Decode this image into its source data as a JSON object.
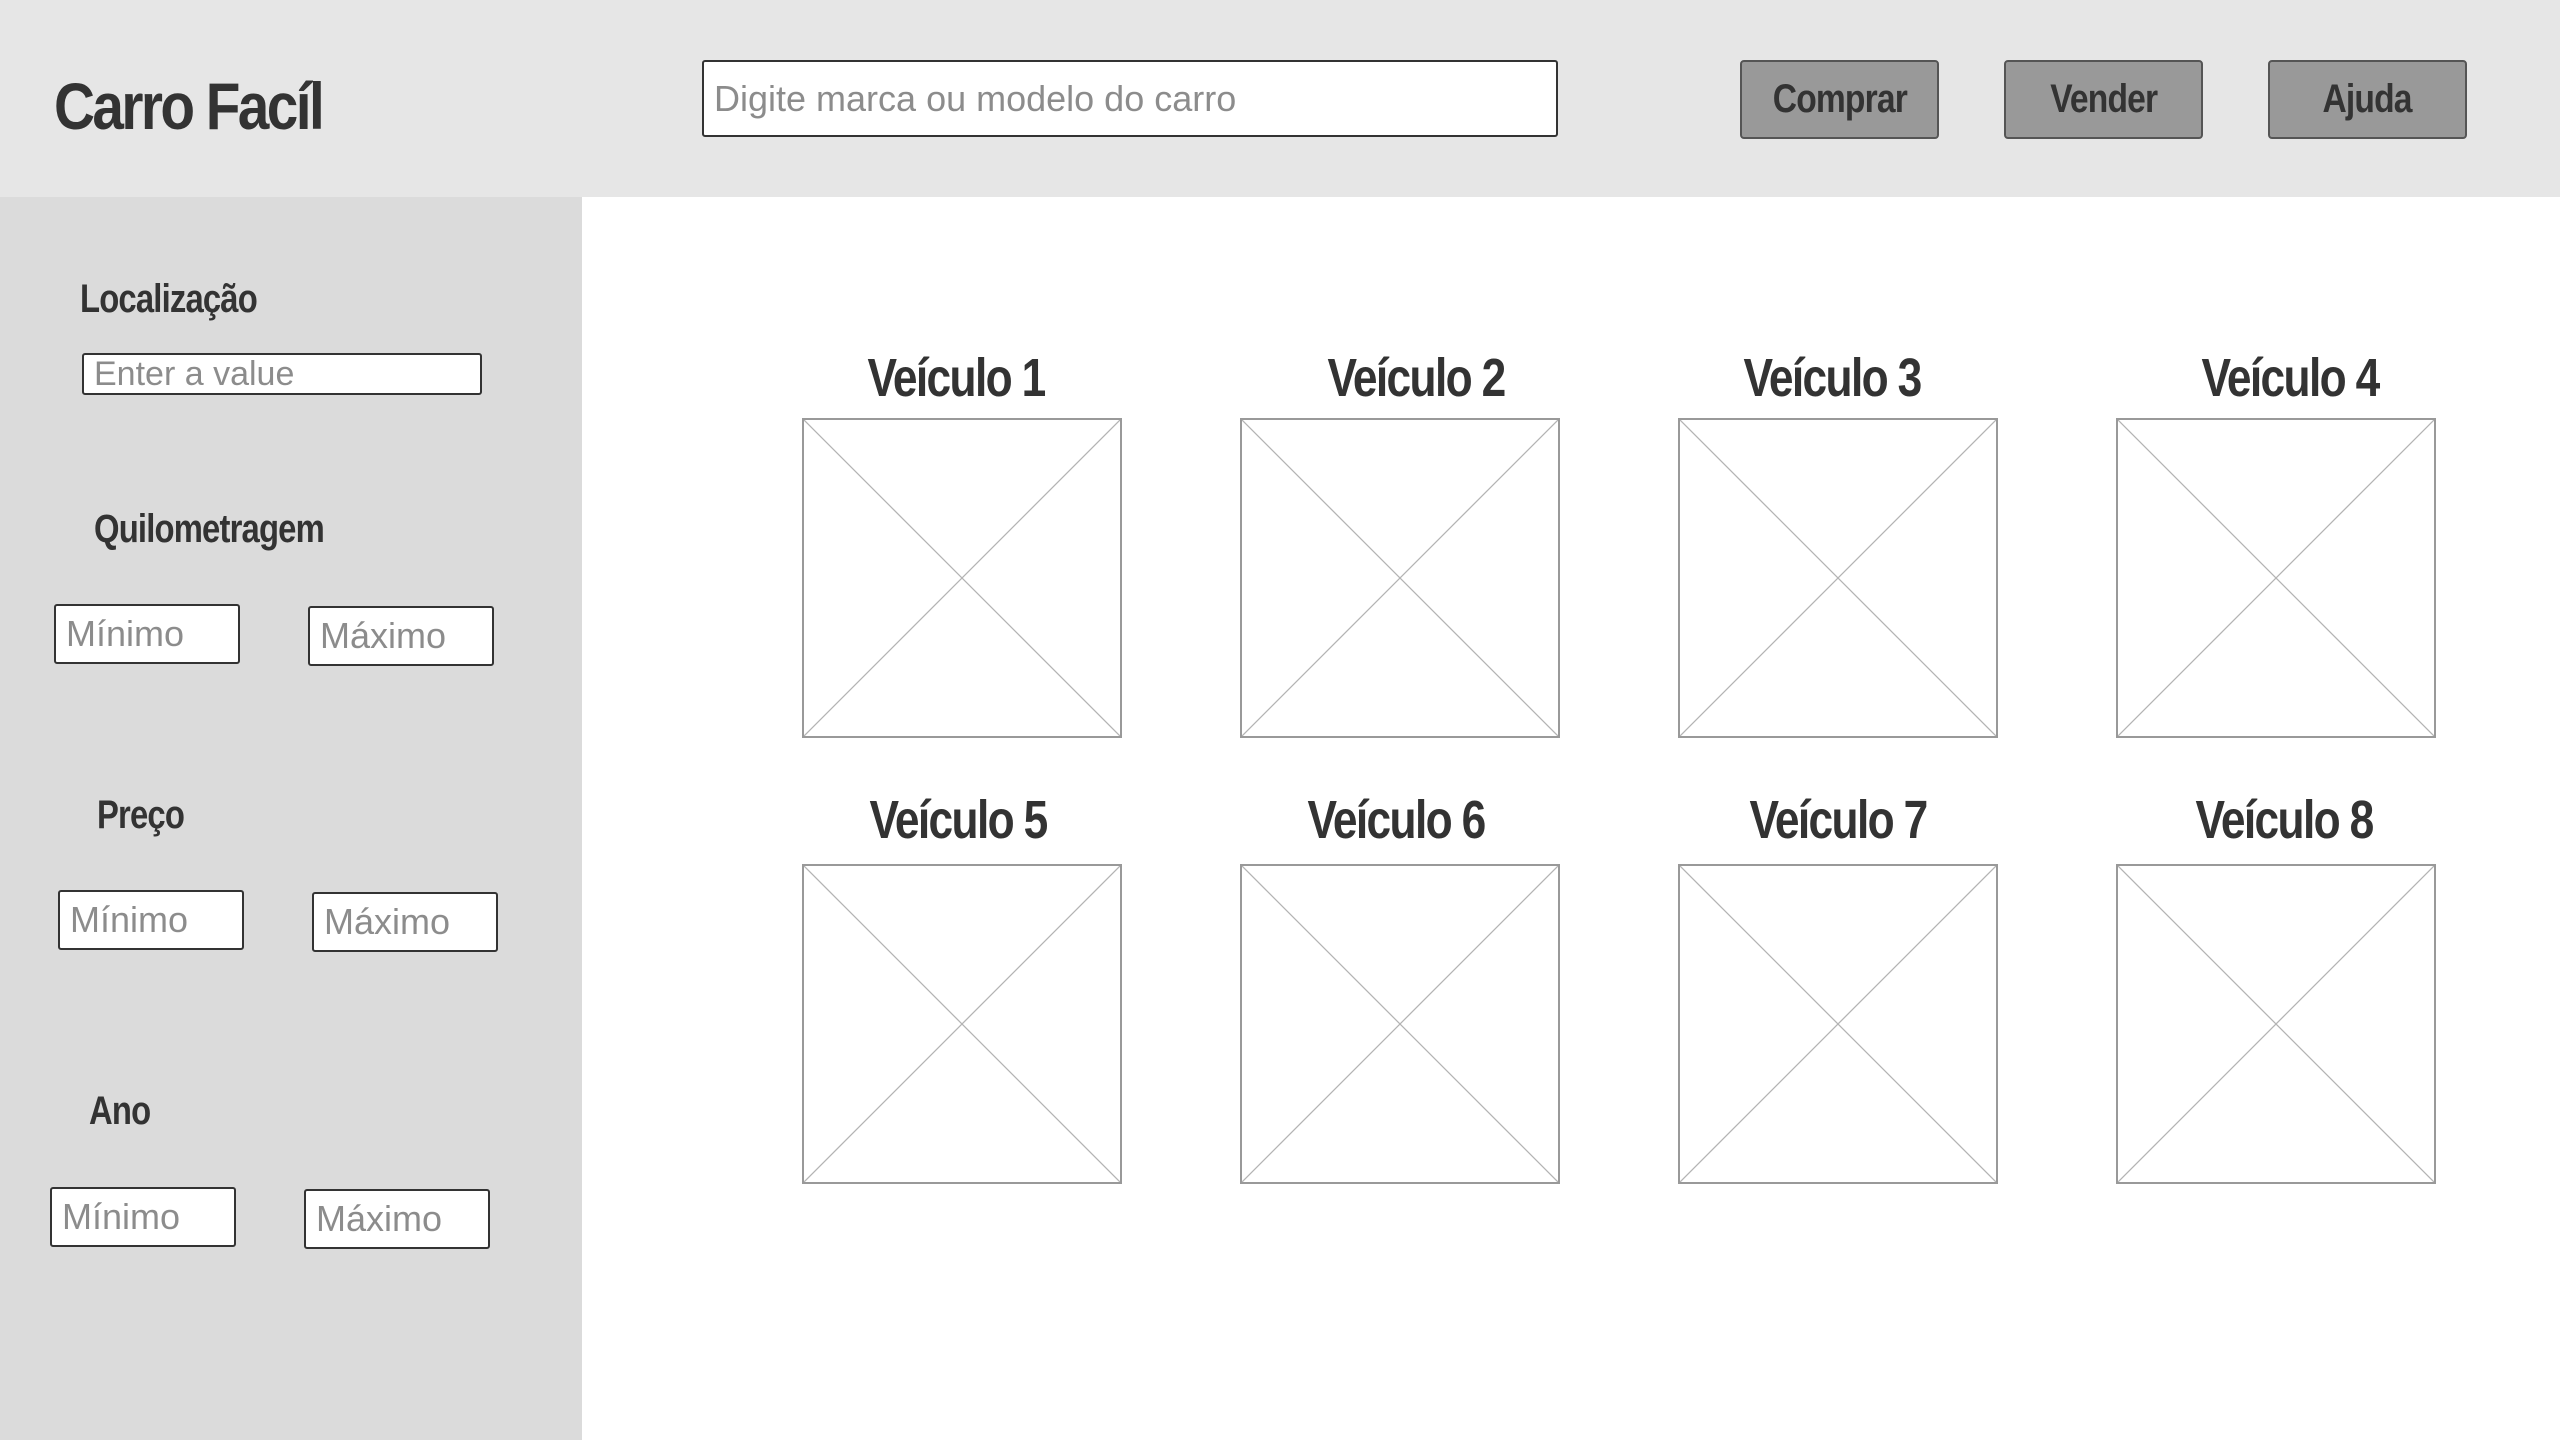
{
  "header": {
    "app_title": "Carro Facíl",
    "search_placeholder": "Digite marca ou modelo do carro",
    "buttons": {
      "buy": "Comprar",
      "sell": "Vender",
      "help": "Ajuda"
    }
  },
  "sidebar": {
    "location": {
      "label": "Localização",
      "placeholder": "Enter a value"
    },
    "mileage": {
      "label": "Quilometragem",
      "min_placeholder": "Mínimo",
      "max_placeholder": "Máximo"
    },
    "price": {
      "label": "Preço",
      "min_placeholder": "Mínimo",
      "max_placeholder": "Máximo"
    },
    "year": {
      "label": "Ano",
      "min_placeholder": "Mínimo",
      "max_placeholder": "Máximo"
    }
  },
  "vehicles": [
    {
      "title": "Veículo 1",
      "image_icon": "image-placeholder-icon"
    },
    {
      "title": "Veículo 2",
      "image_icon": "image-placeholder-icon"
    },
    {
      "title": "Veículo 3",
      "image_icon": "image-placeholder-icon"
    },
    {
      "title": "Veículo 4",
      "image_icon": "image-placeholder-icon"
    },
    {
      "title": "Veículo 5",
      "image_icon": "image-placeholder-icon"
    },
    {
      "title": "Veículo 6",
      "image_icon": "image-placeholder-icon"
    },
    {
      "title": "Veículo 7",
      "image_icon": "image-placeholder-icon"
    },
    {
      "title": "Veículo 8",
      "image_icon": "image-placeholder-icon"
    }
  ],
  "colors": {
    "header_bg": "#e6e6e6",
    "sidebar_bg": "#dbdbdb",
    "button_bg": "#999999",
    "text": "#333333",
    "placeholder": "#8c8c8c"
  }
}
